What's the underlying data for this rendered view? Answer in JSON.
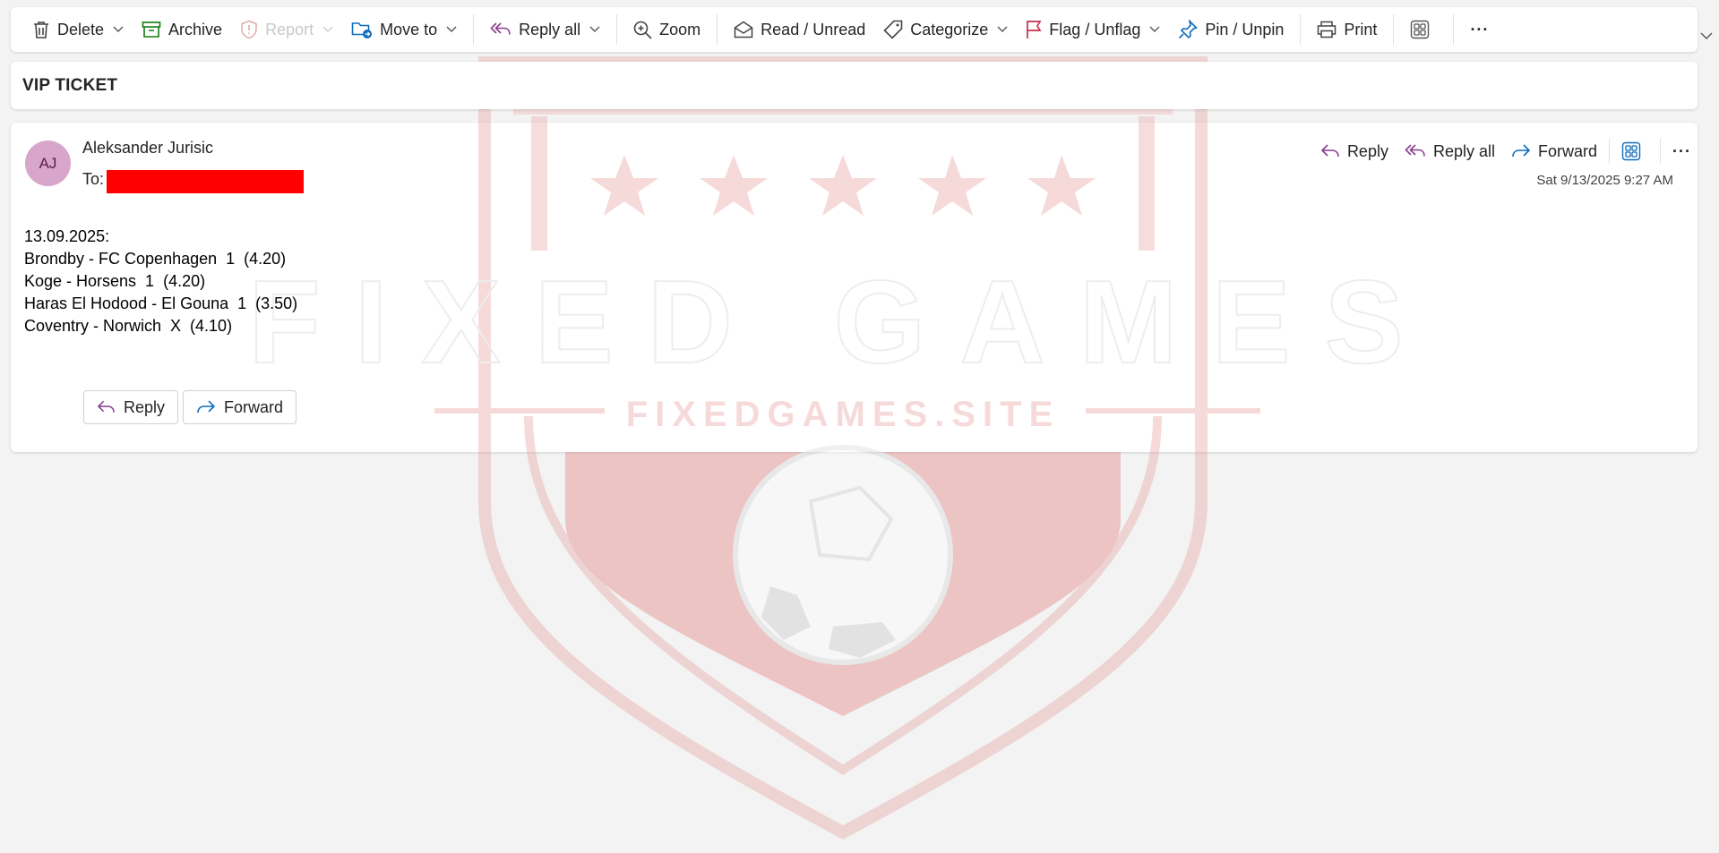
{
  "toolbar": {
    "delete": "Delete",
    "archive": "Archive",
    "report": "Report",
    "move_to": "Move to",
    "reply_all": "Reply all",
    "zoom": "Zoom",
    "read_unread": "Read / Unread",
    "categorize": "Categorize",
    "flag_unflag": "Flag / Unflag",
    "pin_unpin": "Pin / Unpin",
    "print": "Print",
    "more": "···"
  },
  "subject": "VIP TICKET",
  "message": {
    "avatar_initials": "AJ",
    "sender": "Aleksander Jurisic",
    "to_label": "To:",
    "date": "Sat 9/13/2025 9:27 AM",
    "actions": {
      "reply": "Reply",
      "reply_all": "Reply all",
      "forward": "Forward"
    },
    "body_lines": [
      "13.09.2025:",
      "Brondby - FC Copenhagen  1  (4.20)",
      "Koge - Horsens  1  (4.20)",
      "Haras El Hodood - El Gouna  1  (3.50)",
      "Coventry - Norwich  X  (4.10)"
    ],
    "bottom_reply": "Reply",
    "bottom_forward": "Forward"
  },
  "watermark": {
    "title": "FIXED GAMES",
    "site": "FIXEDGAMES.SITE"
  },
  "colors": {
    "accent_blue": "#0f6cbd",
    "reply_purple": "#8a3c8e",
    "flag_red": "#c4314b",
    "archive_green": "#107c10",
    "avatar_bg": "#d8a5cb",
    "redaction": "#ff0000",
    "watermark_red": "#e8a0a0"
  },
  "icons": [
    "trash-icon",
    "archive-icon",
    "report-icon",
    "move-folder-icon",
    "reply-all-icon",
    "zoom-icon",
    "envelope-icon",
    "tag-icon",
    "flag-icon",
    "pin-icon",
    "printer-icon",
    "apps-icon",
    "more-icon",
    "reply-icon",
    "forward-icon"
  ]
}
